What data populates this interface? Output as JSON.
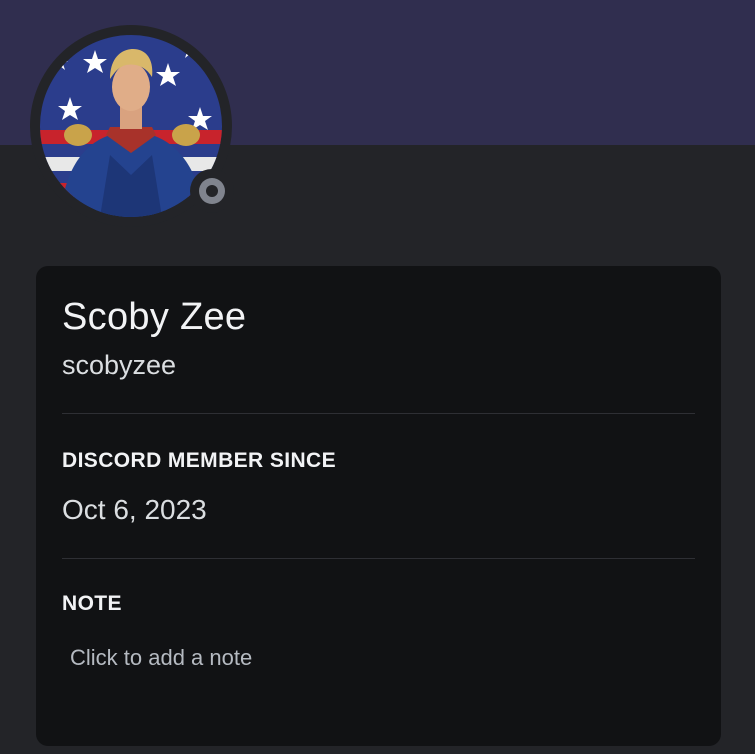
{
  "banner": {
    "color": "#302e4f"
  },
  "avatar": {
    "status": "offline",
    "status_color": "#80848e"
  },
  "profile": {
    "display_name": "Scoby Zee",
    "username": "scobyzee"
  },
  "member_since": {
    "title": "DISCORD MEMBER SINCE",
    "date": "Oct 6, 2023"
  },
  "note": {
    "title": "NOTE",
    "placeholder": "Click to add a note"
  },
  "icons": {
    "status": "status-offline-icon"
  }
}
